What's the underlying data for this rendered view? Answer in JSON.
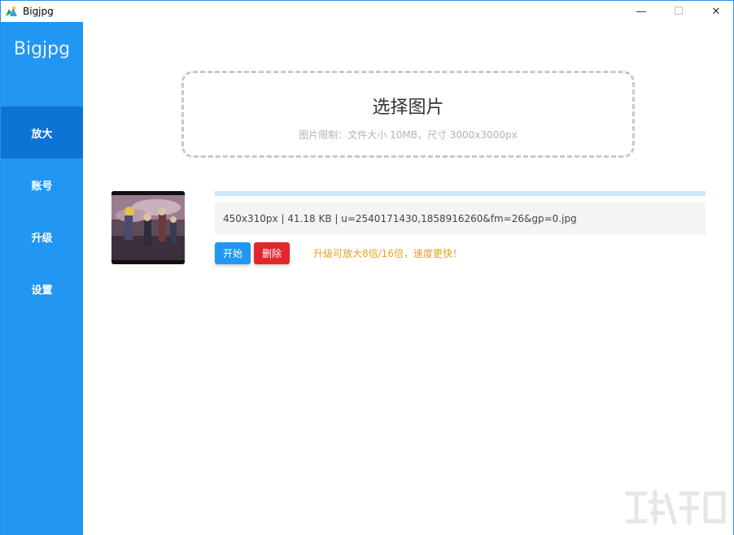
{
  "window": {
    "title": "Bigjpg",
    "minimize_glyph": "—",
    "maximize_glyph": "☐",
    "close_glyph": "✕"
  },
  "sidebar": {
    "brand": "Bigjpg",
    "items": [
      {
        "label": "放大",
        "active": true
      },
      {
        "label": "账号",
        "active": false
      },
      {
        "label": "升级",
        "active": false
      },
      {
        "label": "设置",
        "active": false
      }
    ]
  },
  "dropzone": {
    "title": "选择图片",
    "limits": "图片限制：文件大小 10MB，尺寸 3000x3000px"
  },
  "file": {
    "info": "450x310px | 41.18 KB | u=2540171430,1858916260&fm=26&gp=0.jpg",
    "start_label": "开始",
    "delete_label": "删除",
    "upgrade_tip": "升级可放大8倍/16倍，速度更快！"
  },
  "colors": {
    "sidebar": "#2196f3",
    "sidebar_active": "#0d74d6",
    "start_button": "#2196f3",
    "delete_button": "#e3262c",
    "upgrade_tip": "#e5a21f"
  },
  "icons": {
    "app": "app-logo-icon",
    "thumbnail": "image-thumbnail"
  }
}
